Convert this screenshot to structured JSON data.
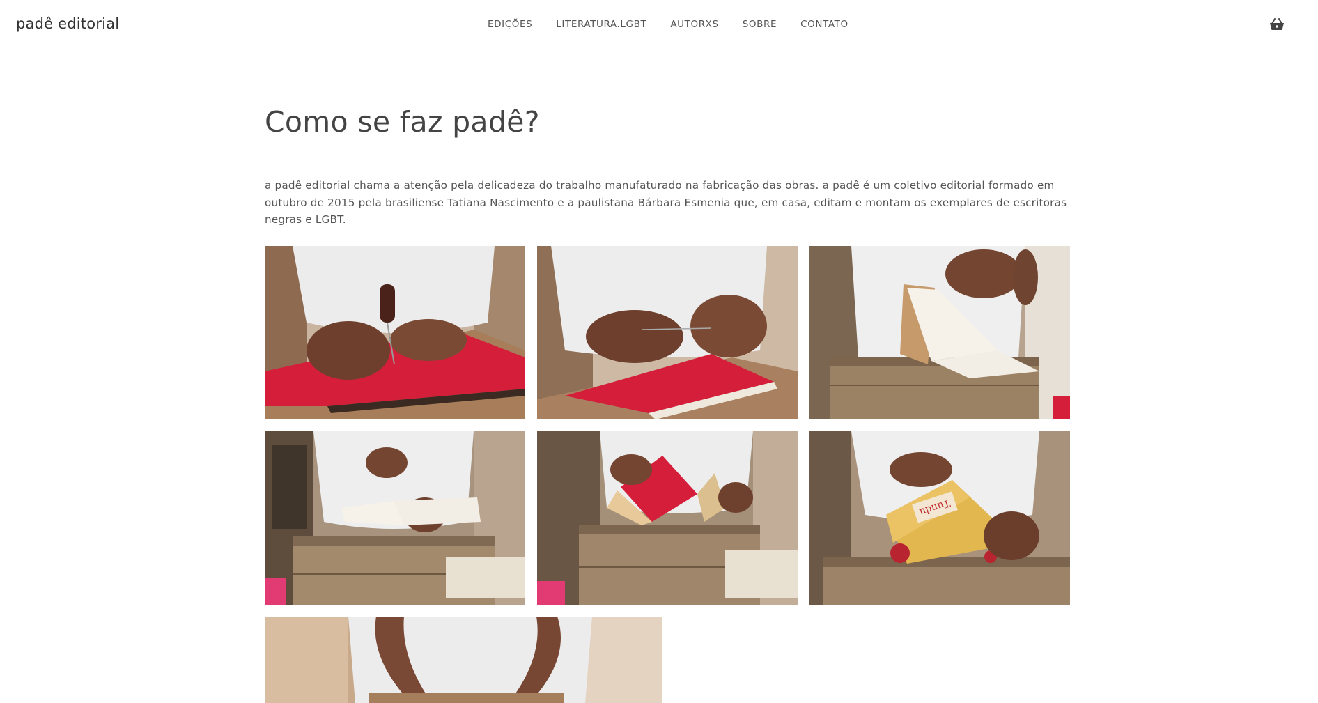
{
  "header": {
    "logo": "padê editorial",
    "nav": [
      {
        "label": "EDIÇÕES"
      },
      {
        "label": "LITERATURA.LGBT"
      },
      {
        "label": "AUTORXS"
      },
      {
        "label": "SOBRE"
      },
      {
        "label": "CONTATO"
      }
    ],
    "cart_icon": "shopping-basket-icon"
  },
  "main": {
    "title": "Como se faz padê?",
    "intro": "a padê editorial chama a atenção pela delicadeza do trabalho manufaturado na fabricação das obras. a padê é um coletivo editorial formado em outubro de 2015 pela brasiliense Tatiana Nascimento e a paulistana Bárbara Esmenia que, em casa, editam e montam os exemplares de escritoras negras e LGBT."
  },
  "gallery": {
    "photos": [
      {
        "subject": "furador-sobre-papel-vermelho"
      },
      {
        "subject": "maos-com-agulha-e-linha"
      },
      {
        "subject": "costura-de-livreto-sobre-caixa"
      },
      {
        "subject": "livreto-aberto-sobre-caixa"
      },
      {
        "subject": "dobrando-capa-vermelha"
      },
      {
        "subject": "envelope-amarelo-com-carimbo"
      },
      {
        "subject": "maos-sobre-mesa"
      }
    ]
  },
  "colors": {
    "text": "#333333",
    "nav_text": "#555555",
    "background": "#ffffff",
    "accent_red": "#d51f3a",
    "skin": "#7a4a35",
    "wood": "#a58464"
  }
}
